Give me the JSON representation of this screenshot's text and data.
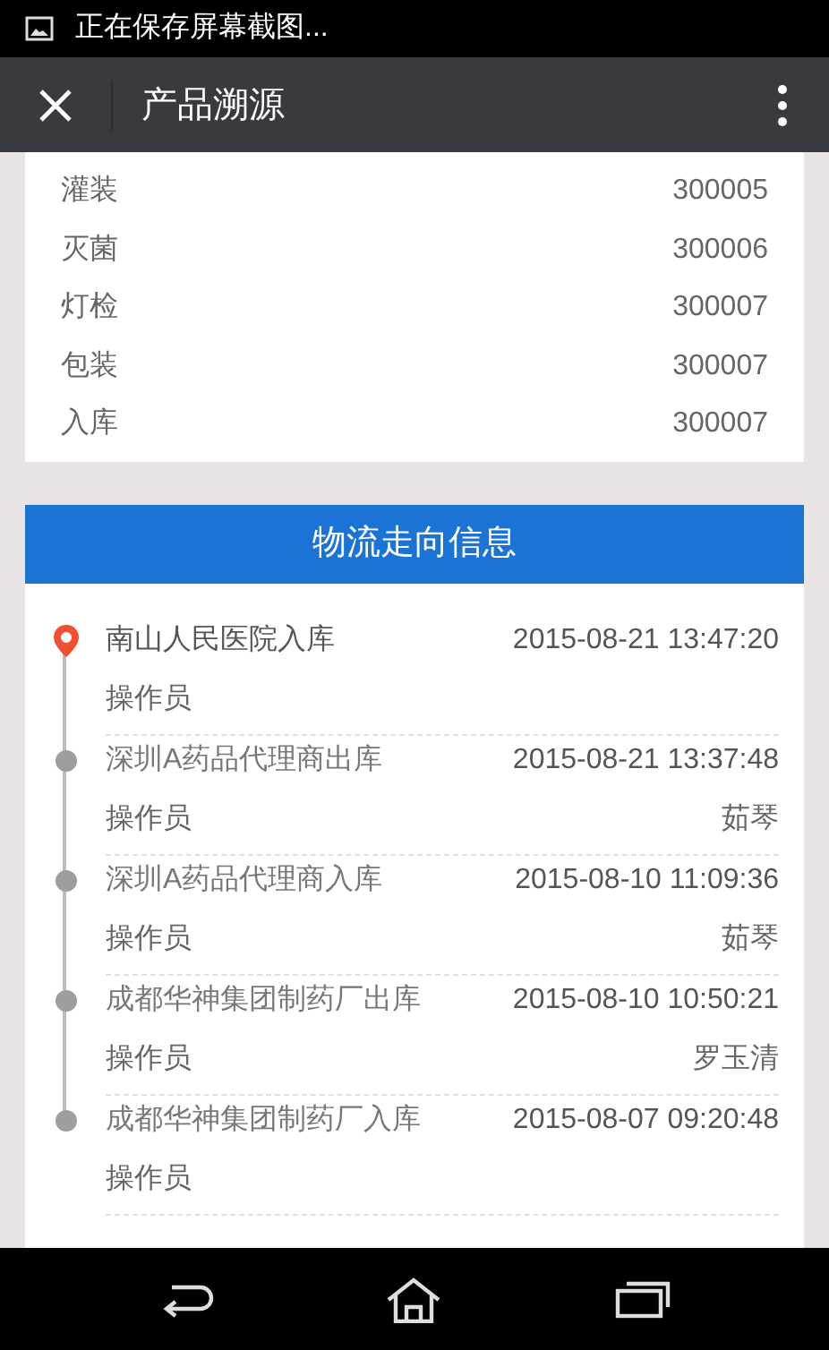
{
  "status_bar": {
    "notification": "正在保存屏幕截图..."
  },
  "app_bar": {
    "title": "产品溯源"
  },
  "process_rows": [
    {
      "label": "灌装",
      "value": "300005"
    },
    {
      "label": "灭菌",
      "value": "300006"
    },
    {
      "label": "灯检",
      "value": "300007"
    },
    {
      "label": "包装",
      "value": "300007"
    },
    {
      "label": "入库",
      "value": "300007"
    }
  ],
  "logistics": {
    "title": "物流走向信息",
    "events": [
      {
        "place": "南山人民医院入库",
        "time": "2015-08-21 13:47:20",
        "operator_label": "操作员",
        "current": true
      },
      {
        "place": "深圳A药品代理商出库",
        "time": "2015-08-21 13:37:48",
        "operator_label": "操作员",
        "operator": "茹琴",
        "current": false
      },
      {
        "place": "深圳A药品代理商入库",
        "time": "2015-08-10 11:09:36",
        "operator_label": "操作员",
        "operator": "茹琴",
        "current": false
      },
      {
        "place": "成都华神集团制药厂出库",
        "time": "2015-08-10 10:50:21",
        "operator_label": "操作员",
        "operator": "罗玉清",
        "current": false
      },
      {
        "place": "成都华神集团制药厂入库",
        "time": "2015-08-07 09:20:48",
        "operator_label": "操作员",
        "current": false
      }
    ]
  }
}
